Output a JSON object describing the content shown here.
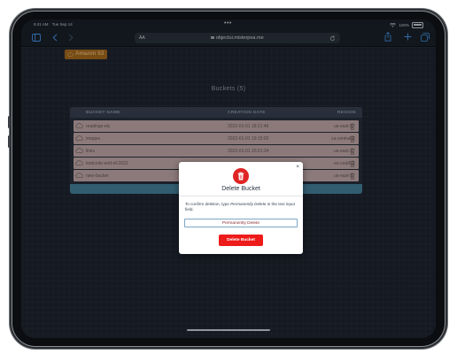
{
  "status_bar": {
    "time": "9:41 AM",
    "date": "Tue Sep 14",
    "dots": "•••",
    "battery": "100%"
  },
  "browser": {
    "text_size_label": "AA",
    "url": "objectui.misterpea.me"
  },
  "page": {
    "brand": "Amazon S3",
    "title": "Buckets (5)",
    "table": {
      "headers": [
        "BUCKET NAME",
        "CREATION DATE",
        "REGION"
      ],
      "rows": [
        {
          "name": "readings-etc",
          "date": "2022-01-01 18:21:46",
          "region": "us-east-2"
        },
        {
          "name": "images",
          "date": "2022-01-01 19:15:02",
          "region": "ca-central-1"
        },
        {
          "name": "links",
          "date": "2022-01-01 20:31:24",
          "region": "us-east-1"
        },
        {
          "name": "leetcode-end-of-2022",
          "date": "",
          "region": "eu-south-1"
        },
        {
          "name": "new-bucket",
          "date": "",
          "region": "us-east-2"
        }
      ]
    }
  },
  "modal": {
    "close": "×",
    "title": "Delete Bucket",
    "instruction_pre": "To confirm deletion, type ",
    "instruction_em": "Permanently Delete",
    "instruction_post": " in the text input field.",
    "input_value": "Permanently Delete",
    "button": "Delete Bucket"
  },
  "icons": {
    "trash": "trash-icon",
    "cloud": "cloud-icon",
    "lock": "lock-icon",
    "reload": "reload-icon",
    "sidebar": "sidebar-icon",
    "share": "share-icon",
    "add": "plus-icon",
    "tabs": "tabs-icon"
  },
  "colors": {
    "accent": "#4aa3ff",
    "danger": "#ee1b1b",
    "brand_bg": "#b2711f",
    "row_bg": "#cfb4b4"
  }
}
